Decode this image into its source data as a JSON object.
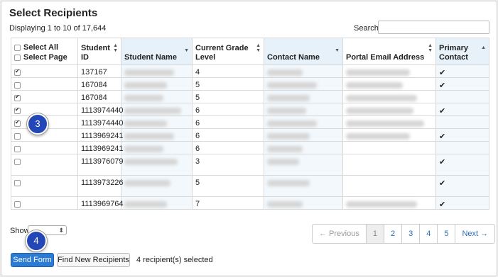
{
  "header": {
    "title": "Select Recipients",
    "displaying": "Displaying 1 to 10 of 17,644",
    "search_label": "Search",
    "search_value": ""
  },
  "table": {
    "select_all_label": "Select All",
    "select_page_label": "Select Page",
    "columns": [
      "Student ID",
      "Student Name",
      "Current Grade Level",
      "Contact Name",
      "Portal Email Address",
      "Primary Contact"
    ],
    "rows": [
      {
        "checked": true,
        "student_id": "137167",
        "grade": "4",
        "primary": "✔"
      },
      {
        "checked": false,
        "student_id": "167084",
        "grade": "5",
        "primary": "✔"
      },
      {
        "checked": true,
        "student_id": "167084",
        "grade": "5",
        "primary": ""
      },
      {
        "checked": true,
        "student_id": "1113974440",
        "grade": "6",
        "primary": "✔"
      },
      {
        "checked": true,
        "student_id": "1113974440",
        "grade": "6",
        "primary": ""
      },
      {
        "checked": false,
        "student_id": "1113969241",
        "grade": "6",
        "primary": "✔"
      },
      {
        "checked": false,
        "student_id": "1113969241",
        "grade": "6",
        "primary": ""
      },
      {
        "checked": false,
        "student_id": "1113976079",
        "grade": "3",
        "primary": "✔"
      },
      {
        "checked": false,
        "student_id": "1113973226",
        "grade": "5",
        "primary": "✔"
      },
      {
        "checked": false,
        "student_id": "1113969764",
        "grade": "7",
        "primary": "✔"
      }
    ]
  },
  "footer": {
    "show_label": "Show",
    "show_value": "",
    "pagination": [
      "← Previous",
      "1",
      "2",
      "3",
      "4",
      "5",
      "Next →"
    ],
    "send_button": "Send Form",
    "find_button": "Find New Recipients",
    "selected_text": "4 recipient(s) selected"
  },
  "callouts": [
    "3",
    "4"
  ],
  "colors": {
    "primary": "#2a7bd1",
    "callout": "#2447b8",
    "sorted_header": "#e6f1f9"
  }
}
